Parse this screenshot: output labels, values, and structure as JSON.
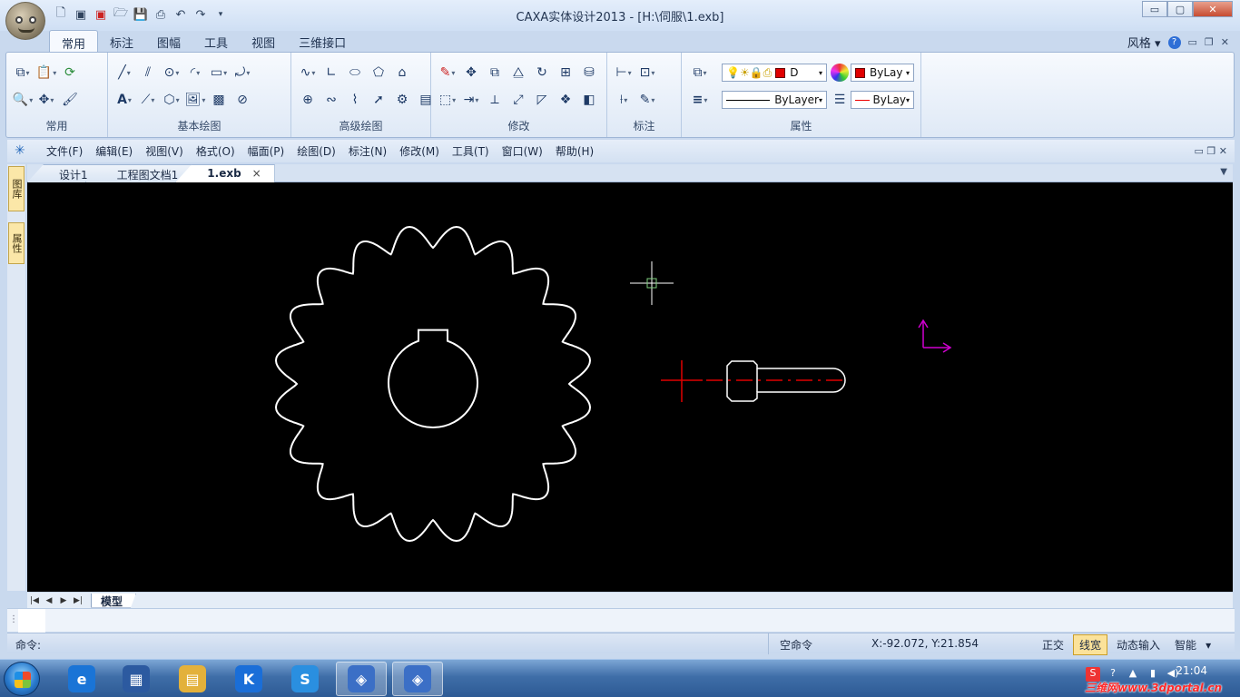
{
  "window": {
    "title": "CAXA实体设计2013 - [H:\\伺服\\1.exb]",
    "minimize": "▭",
    "maximize": "▢",
    "close": "✕"
  },
  "ribbon": {
    "tabs": [
      {
        "label": "常用",
        "active": true
      },
      {
        "label": "标注",
        "active": false
      },
      {
        "label": "图幅",
        "active": false
      },
      {
        "label": "工具",
        "active": false
      },
      {
        "label": "视图",
        "active": false
      },
      {
        "label": "三维接口",
        "active": false
      }
    ],
    "style_label": "风格",
    "groups": {
      "common": "常用",
      "basic_draw": "基本绘图",
      "advanced_draw": "高级绘图",
      "modify": "修改",
      "dimension": "标注",
      "properties": "属性"
    },
    "properties": {
      "layer_value": "D",
      "color_value": "ByLay",
      "linetype_value": "ByLayer",
      "lineweight_value": "ByLay",
      "color_swatch": "#e00000"
    }
  },
  "menu": {
    "items": [
      "文件(F)",
      "编辑(E)",
      "视图(V)",
      "格式(O)",
      "幅面(P)",
      "绘图(D)",
      "标注(N)",
      "修改(M)",
      "工具(T)",
      "窗口(W)",
      "帮助(H)"
    ]
  },
  "side_panel": {
    "tabs": [
      "图库",
      "属性"
    ]
  },
  "doc_tabs": [
    {
      "label": "设计1",
      "active": false
    },
    {
      "label": "工程图文档1",
      "active": false
    },
    {
      "label": "1.exb",
      "active": true,
      "close": "×"
    }
  ],
  "sheet": {
    "tab": "模型"
  },
  "status": {
    "prompt": "命令:",
    "state": "空命令",
    "coords": "X:-92.072, Y:21.854",
    "modes": [
      {
        "label": "正交",
        "on": false
      },
      {
        "label": "线宽",
        "on": true
      },
      {
        "label": "动态输入",
        "on": false
      },
      {
        "label": "智能",
        "on": false
      }
    ]
  },
  "drawing": {
    "gear_teeth": 20,
    "line_color": "#ffffff",
    "part_color": "#e00000",
    "axis_color": "#d000d0",
    "crosshair_color": "#ffffff"
  },
  "taskbar": {
    "apps": [
      {
        "name": "internet-explorer",
        "letter": "e",
        "color": "#1a74d6"
      },
      {
        "name": "media-player",
        "letter": "▦",
        "color": "#2c5aa0"
      },
      {
        "name": "file-explorer",
        "letter": "▤",
        "color": "#e3b13b"
      },
      {
        "name": "kugou",
        "letter": "K",
        "color": "#1a6ed8"
      },
      {
        "name": "sogou",
        "letter": "S",
        "color": "#2a8fe0"
      },
      {
        "name": "caxa-1",
        "letter": "◈",
        "color": "#3b6fc6"
      },
      {
        "name": "caxa-2",
        "letter": "◈",
        "color": "#3b6fc6"
      }
    ],
    "time": "21:04",
    "watermark": "三维网www.3dportal.cn"
  }
}
